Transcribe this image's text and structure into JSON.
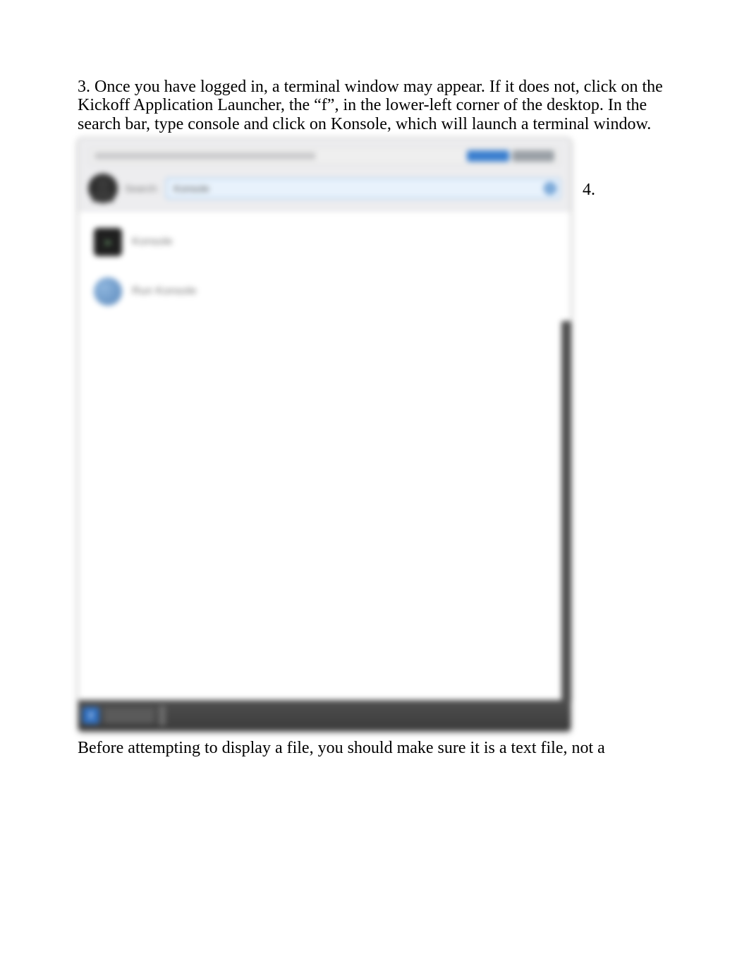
{
  "step3": {
    "text": "3. Once you have logged in, a terminal window may appear. If it does not, click on the Kickoff Application Launcher, the “f”, in the lower-left corner of the desktop. In the search bar, type console and click on Konsole, which will launch a terminal window."
  },
  "floating_marker": "4.",
  "launcher": {
    "search_label": "Search:",
    "search_value": "Konsole",
    "clear_glyph": "×",
    "results": [
      {
        "label": "Konsole",
        "icon": "terminal"
      },
      {
        "label": "Run Konsole",
        "icon": "run"
      }
    ],
    "start_glyph": "f"
  },
  "after_text": "Before attempting to display a file, you should make sure it is a text file, not a"
}
